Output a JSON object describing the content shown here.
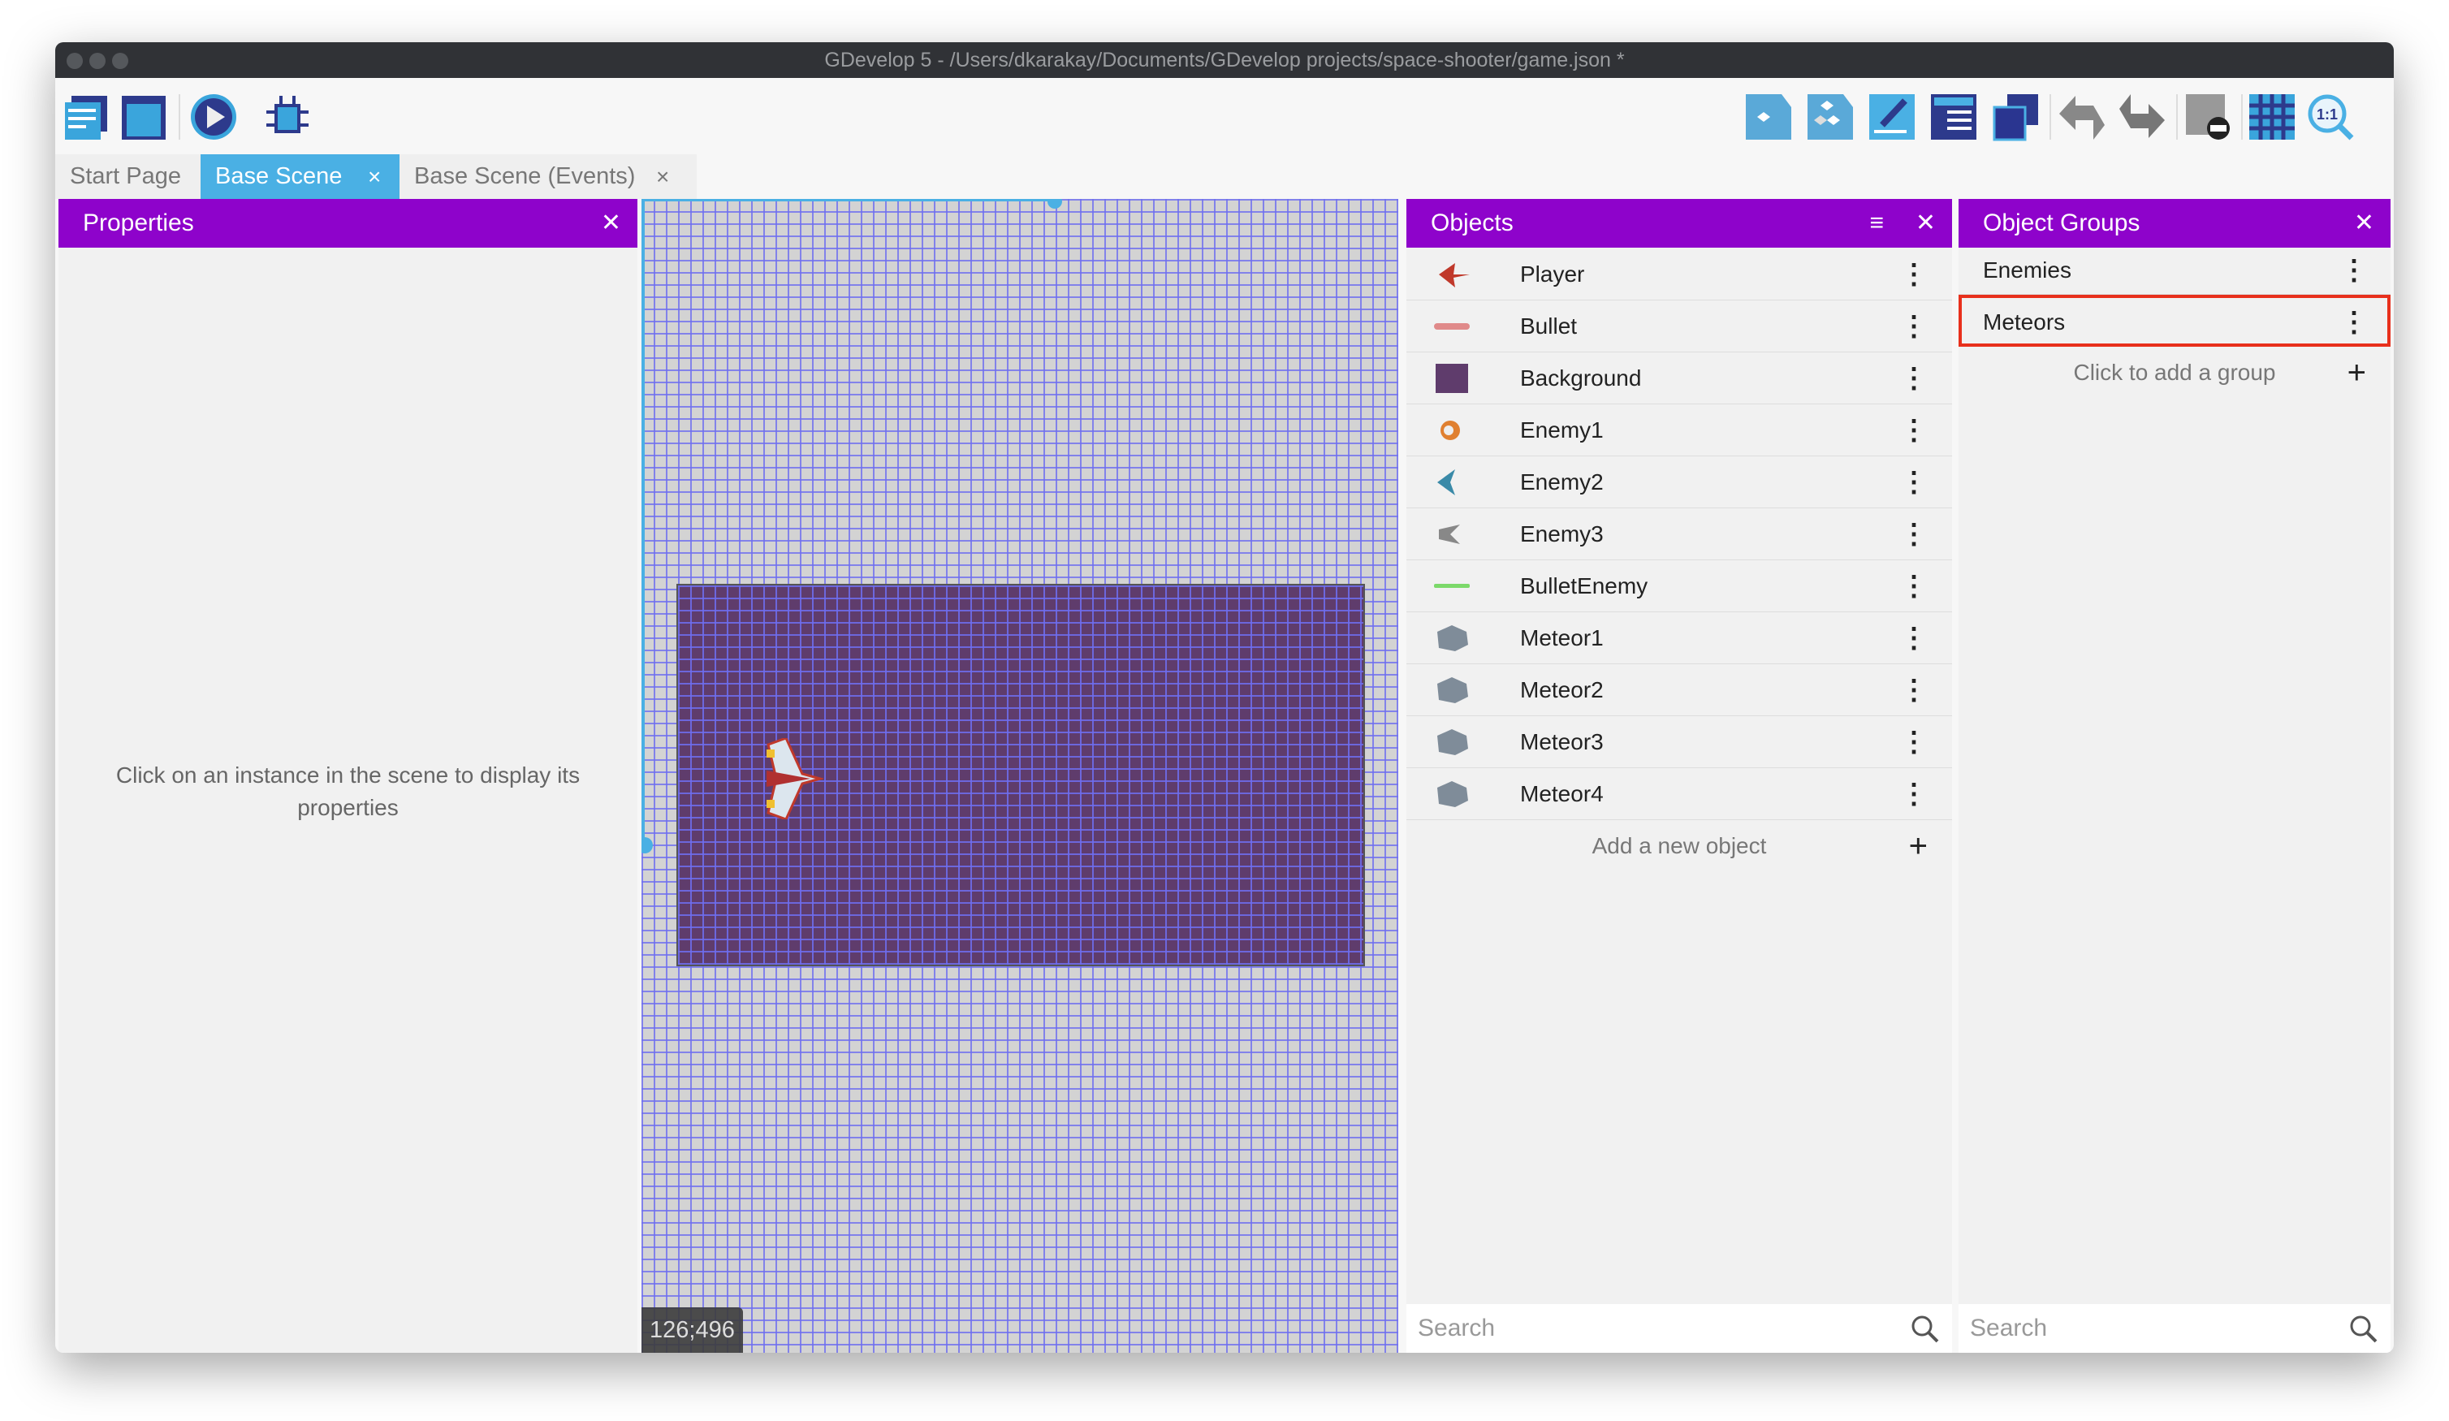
{
  "window": {
    "title": "GDevelop 5 - /Users/dkarakay/Documents/GDevelop projects/space-shooter/game.json *"
  },
  "toolbar": {
    "left_icons": [
      "project-manager-icon",
      "scene-icon",
      "preview-play-icon",
      "debugger-icon"
    ],
    "right_icons": [
      "object-editor-icon",
      "object-groups-icon",
      "properties-edit-icon",
      "instances-list-icon",
      "layers-icon",
      "undo-icon",
      "redo-icon",
      "delete-selection-icon",
      "grid-icon",
      "zoom-reset-icon"
    ]
  },
  "tabs": [
    {
      "label": "Start Page",
      "closable": false
    },
    {
      "label": "Base Scene",
      "closable": true,
      "active": true
    },
    {
      "label": "Base Scene (Events)",
      "closable": true
    }
  ],
  "tab_close": "×",
  "properties": {
    "title": "Properties",
    "empty_message": "Click on an instance in the scene to display its properties"
  },
  "canvas": {
    "coordinates": "126;496"
  },
  "objects": {
    "title": "Objects",
    "items": [
      {
        "name": "Player"
      },
      {
        "name": "Bullet"
      },
      {
        "name": "Background"
      },
      {
        "name": "Enemy1"
      },
      {
        "name": "Enemy2"
      },
      {
        "name": "Enemy3"
      },
      {
        "name": "BulletEnemy"
      },
      {
        "name": "Meteor1"
      },
      {
        "name": "Meteor2"
      },
      {
        "name": "Meteor3"
      },
      {
        "name": "Meteor4"
      }
    ],
    "add_label": "Add a new object",
    "search_placeholder": "Search"
  },
  "groups": {
    "title": "Object Groups",
    "items": [
      {
        "name": "Enemies"
      },
      {
        "name": "Meteors",
        "highlighted": true
      }
    ],
    "add_label": "Click to add a group",
    "search_placeholder": "Search"
  },
  "colors": {
    "panel_header": "#8e03cb",
    "active_tab": "#4ab0e4",
    "highlight": "#e8301c",
    "scene_bg": "#5f3c6c"
  }
}
